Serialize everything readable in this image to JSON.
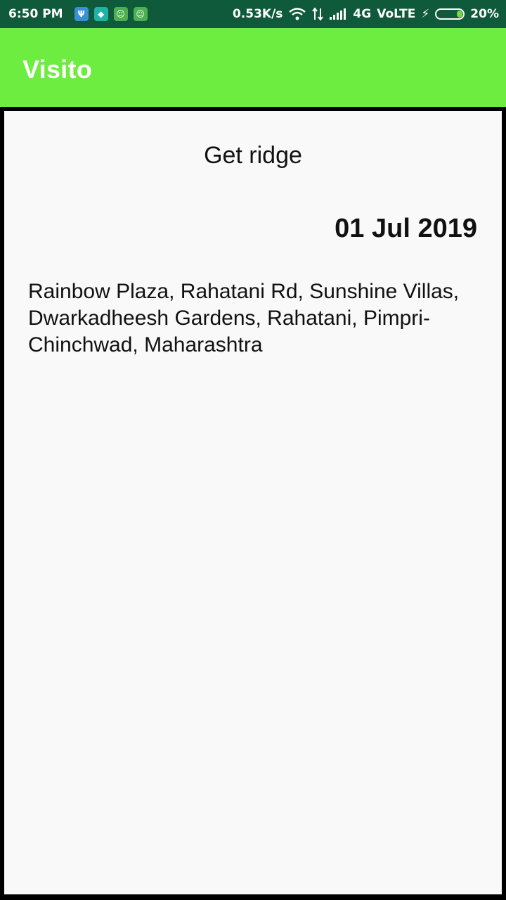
{
  "statusbar": {
    "time": "6:50 PM",
    "net_speed": "0.53K/s",
    "network": "4G",
    "volte": "VoLTE",
    "battery": "20%",
    "battery_level": 0.2,
    "icons": [
      "usb-icon",
      "shield-icon",
      "android-icon",
      "android-icon",
      "wifi-icon",
      "data-arrows-icon",
      "signal-icon",
      "charging-icon",
      "battery-icon"
    ]
  },
  "appbar": {
    "title": "Visito",
    "color": "#6ded40"
  },
  "main": {
    "heading": "Get ridge",
    "date": "01 Jul 2019",
    "address": "Rainbow Plaza, Rahatani Rd, Sunshine Villas, Dwarkadheesh Gardens, Rahatani, Pimpri-Chinchwad, Maharashtra"
  }
}
